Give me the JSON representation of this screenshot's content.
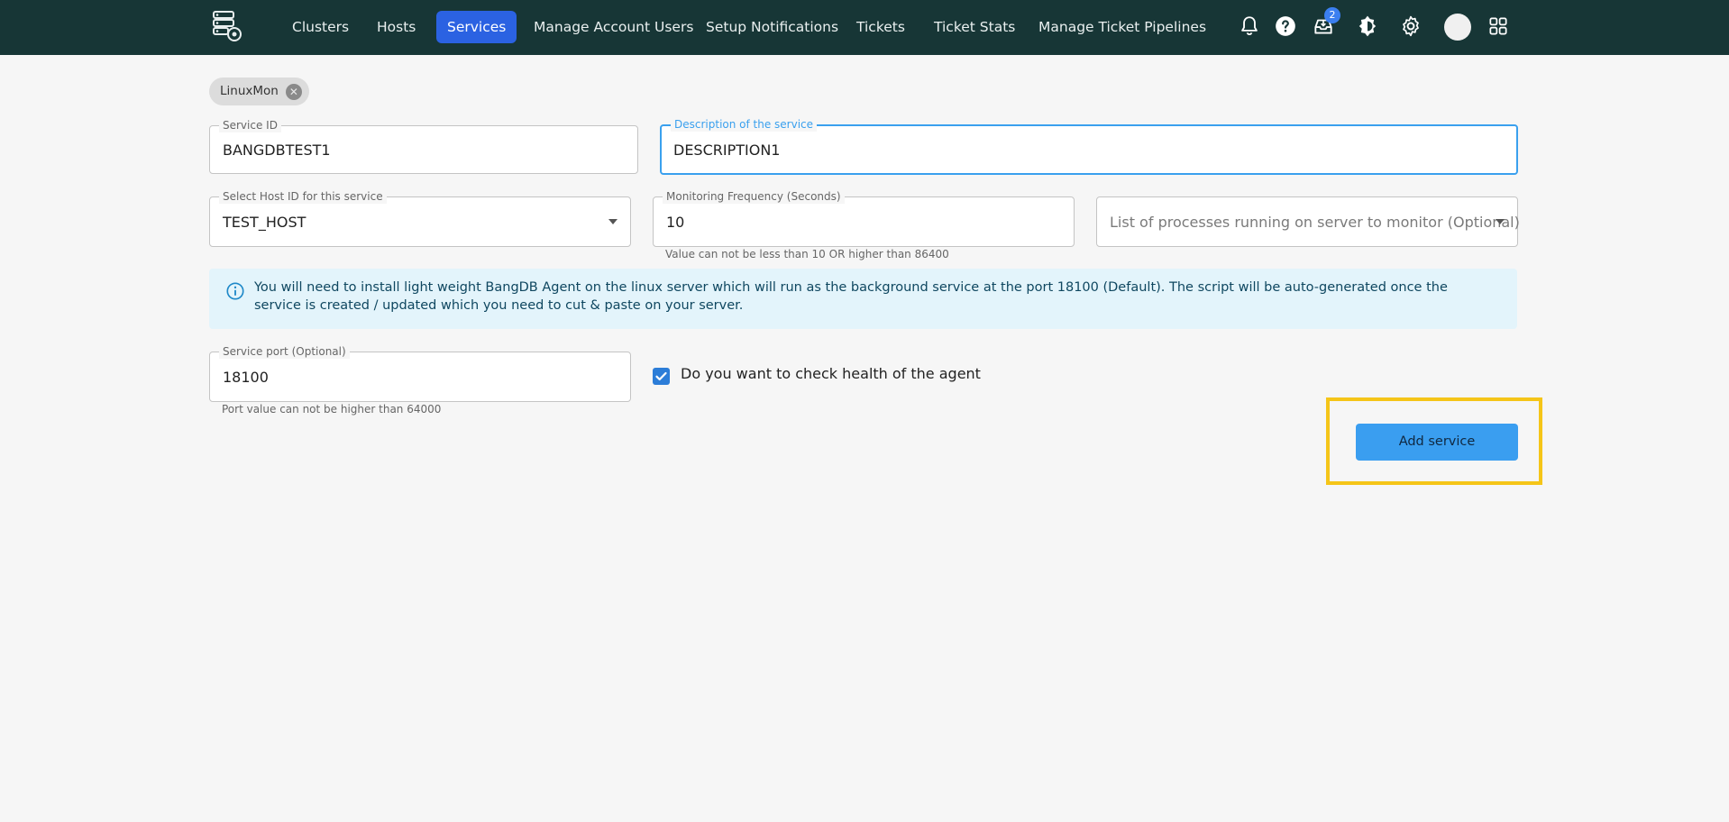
{
  "nav": {
    "items": [
      {
        "label": "Clusters",
        "active": false
      },
      {
        "label": "Hosts",
        "active": false
      },
      {
        "label": "Services",
        "active": true
      },
      {
        "label": "Manage Account Users",
        "active": false
      },
      {
        "label": "Setup Notifications",
        "active": false
      },
      {
        "label": "Tickets",
        "active": false
      },
      {
        "label": "Ticket Stats",
        "active": false
      },
      {
        "label": "Manage Ticket Pipelines",
        "active": false
      }
    ],
    "inbox_badge": "2",
    "icons": [
      "bell-icon",
      "help-icon",
      "inbox-icon",
      "theme-toggle-icon",
      "gear-icon",
      "avatar",
      "apps-grid-icon"
    ]
  },
  "chip": {
    "label": "LinuxMon"
  },
  "form": {
    "service_id": {
      "label": "Service ID",
      "value": "BANGDBTEST1"
    },
    "description": {
      "label": "Description of the service",
      "value": "DESCRIPTION1"
    },
    "host_id": {
      "label": "Select Host ID for this service",
      "value": "TEST_HOST"
    },
    "frequency": {
      "label": "Monitoring Frequency (Seconds)",
      "value": "10",
      "helper": "Value can not be less than 10 OR higher than 86400"
    },
    "processes": {
      "placeholder": "List of processes running on server to monitor (Optional)"
    },
    "port": {
      "label": "Service port (Optional)",
      "value": "18100",
      "helper": "Port value can not be higher than 64000"
    },
    "health_check": {
      "label": "Do you want to check health of the agent",
      "checked": true
    },
    "submit_label": "Add service"
  },
  "info": {
    "text": "You will need to install light weight BangDB Agent on the linux server which will run as the background service at the port 18100 (Default). The script will be auto-generated once the service is created / updated which you need to cut & paste on your server."
  },
  "colors": {
    "topbar": "#173636",
    "active_nav": "#2b62e2",
    "accent": "#3a9ef0",
    "highlight": "#f5c518",
    "info_bg": "#e3f4fb"
  }
}
